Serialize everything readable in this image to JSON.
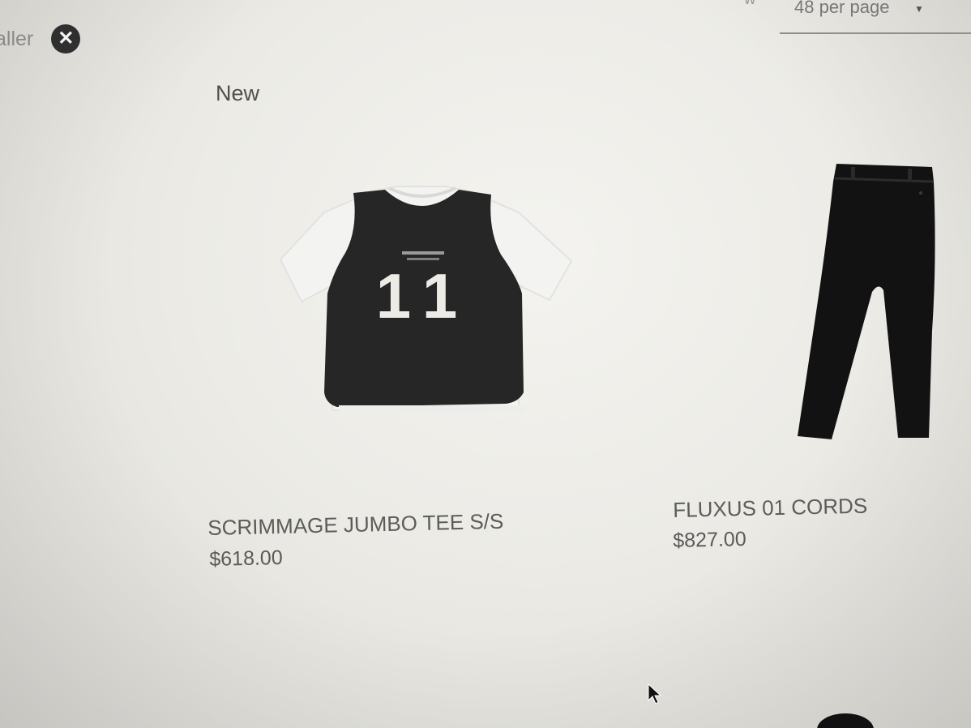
{
  "toolbar": {
    "filter_chip_label": "aller",
    "remove_filter_icon": "close-circle-icon",
    "header_partial": "w",
    "per_page_label": "48 per page",
    "per_page_caret_icon": "caret-down-icon"
  },
  "section": {
    "label": "New"
  },
  "products": [
    {
      "title": "SCRIMMAGE JUMBO TEE S/S",
      "price": "$618.00",
      "jersey_number": "11",
      "image_icon": "tee-with-mesh-vest-image"
    },
    {
      "title": "FLUXUS 01 CORDS",
      "price": "$827.00",
      "image_icon": "black-cords-trousers-image"
    }
  ],
  "colors": {
    "background": "#ecebe6",
    "text": "#5c5c5a",
    "garment_dark": "#232323",
    "garment_light": "#f3f3f1"
  }
}
